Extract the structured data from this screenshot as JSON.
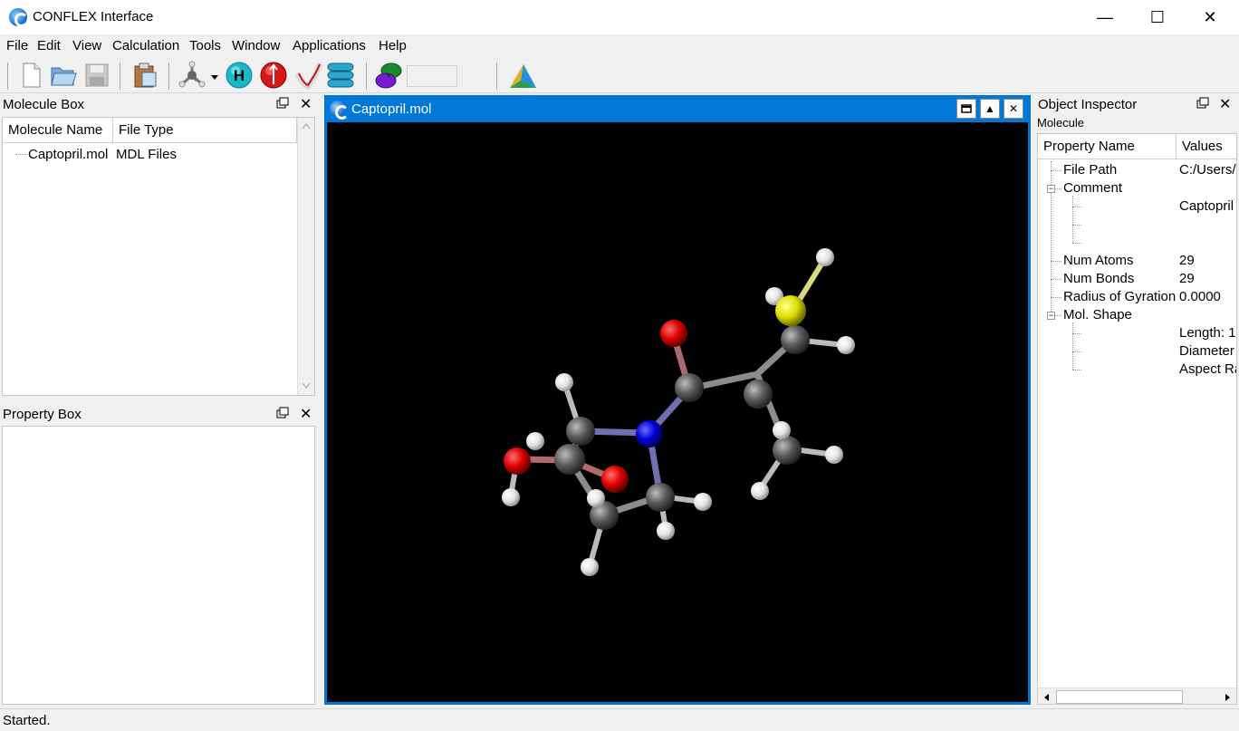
{
  "app": {
    "title": "CONFLEX Interface"
  },
  "window_controls": {
    "minimize": "—",
    "maximize": "☐",
    "close": "✕"
  },
  "menu": [
    "File",
    "Edit",
    "View",
    "Calculation",
    "Tools",
    "Window",
    "Applications",
    "Help"
  ],
  "toolbar": {
    "text_field_value": ""
  },
  "molecule_box": {
    "title": "Molecule Box",
    "columns": [
      "Molecule Name",
      "File Type"
    ],
    "rows": [
      {
        "name": "Captopril.mol",
        "type": "MDL Files"
      }
    ]
  },
  "property_box": {
    "title": "Property Box"
  },
  "viewer": {
    "title": "Captopril.mol",
    "background": "#000000"
  },
  "object_inspector": {
    "title": "Object Inspector",
    "subtitle": "Molecule",
    "columns": [
      "Property Name",
      "Values"
    ],
    "rows": [
      {
        "name": "File Path",
        "value": "C:/Users/c"
      },
      {
        "name": "Comment",
        "value": ""
      },
      {
        "name": "",
        "value": "Captopril"
      },
      {
        "name": "",
        "value": ""
      },
      {
        "name": "",
        "value": ""
      },
      {
        "name": "Num Atoms",
        "value": "29"
      },
      {
        "name": "Num Bonds",
        "value": "29"
      },
      {
        "name": "Radius of Gyration",
        "value": "0.0000"
      },
      {
        "name": "Mol. Shape",
        "value": ""
      },
      {
        "name": "",
        "value": "Length: 1"
      },
      {
        "name": "",
        "value": "Diameter"
      },
      {
        "name": "",
        "value": "Aspect Ra"
      }
    ]
  },
  "status": {
    "text": "Started."
  },
  "colors": {
    "accent": "#0078d7",
    "carbon": "#555555",
    "hydrogen": "#eeeeee",
    "oxygen": "#e00000",
    "nitrogen": "#0000e0",
    "sulfur": "#e6e600"
  }
}
